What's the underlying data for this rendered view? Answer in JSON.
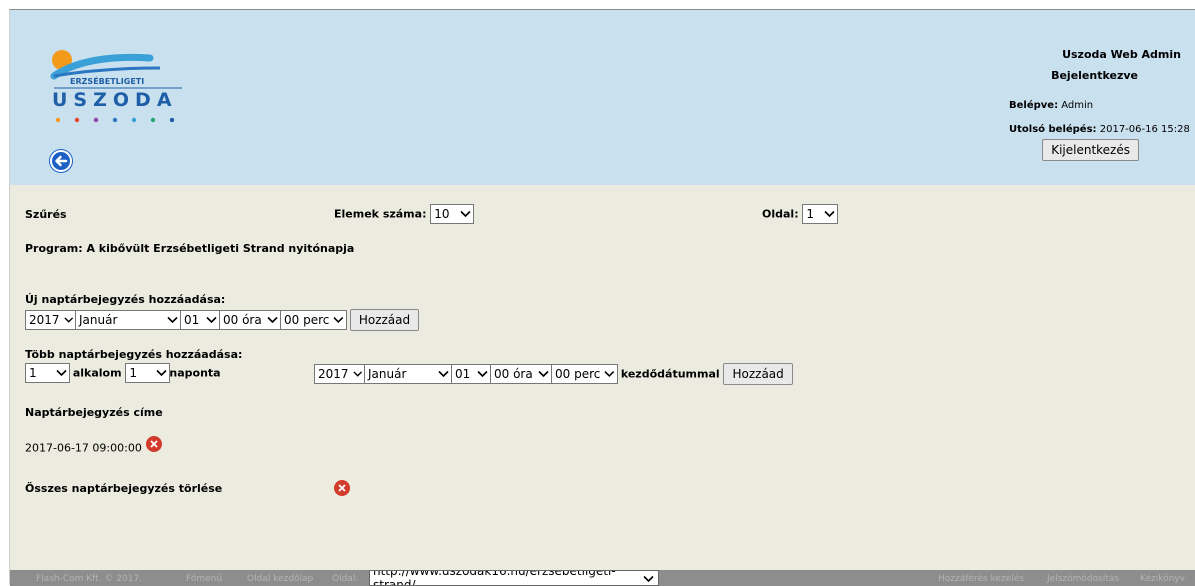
{
  "header": {
    "logo_top": "ERZSÉBETLIGETI",
    "logo_main": "USZODA",
    "app_title": "Uszoda Web Admin",
    "status": "Bejelentkezve",
    "logged_in_label": "Belépve:",
    "logged_in_value": "Admin",
    "last_login_label": "Utolsó belépés:",
    "last_login_value": "2017-06-16 15:28",
    "logout_label": "Kijelentkezés"
  },
  "filter": {
    "title": "Szűrés",
    "items_label": "Elemek száma:",
    "items_value": "10",
    "page_label": "Oldal:",
    "page_value": "1"
  },
  "program": "Program: A kibővült Erzsébetligeti Strand nyitónapja",
  "new_entry": {
    "title": "Új naptárbejegyzés hozzáadása:",
    "year": "2017",
    "month": "Január",
    "day": "01",
    "hour": "00 óra",
    "minute": "00 perc",
    "add_label": "Hozzáad"
  },
  "multi_entry": {
    "title": "Több naptárbejegyzés hozzáadása:",
    "count": "1",
    "count_label": "alkalom",
    "every": "1",
    "every_label": "naponta",
    "year": "2017",
    "month": "Január",
    "day": "01",
    "hour": "00 óra",
    "minute": "00 perc",
    "start_label": "kezdődátummal",
    "add_label": "Hozzáad"
  },
  "entries": {
    "title": "Naptárbejegyzés címe",
    "items": [
      "2017-06-17 09:00:00"
    ],
    "delete_all_label": "Összes naptárbejegyzés törlése"
  },
  "footer": {
    "copyright": "Flash-Com Kft. © 2017.",
    "links_left": [
      "Főmenü",
      "Oldal kezdőlap"
    ],
    "page_label": "Oldal:",
    "page_url": "http://www.uszodak16.hu/erzsebetligeti-strand/",
    "links_right": [
      "Hozzáférés kezelés",
      "Jelszómódosítás",
      "Kézikönyv"
    ]
  },
  "colors": {
    "header_bg": "#c9e0ef",
    "body_bg": "#ebebdf",
    "footer_bg": "#8d8d8d",
    "logo_blue": "#1f5fa8",
    "logo_orange": "#f39a1b",
    "delete_red": "#d23b2b"
  },
  "icons": {
    "back": "arrow-left-circle-icon",
    "delete": "x-circle-icon",
    "select": "chevron-down-icon"
  }
}
